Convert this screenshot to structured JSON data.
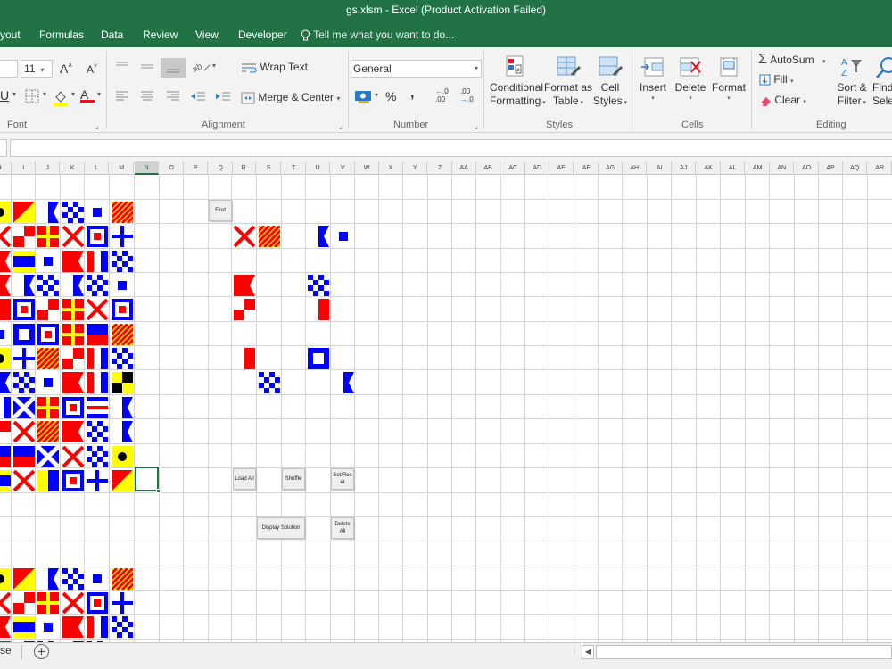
{
  "window": {
    "title": "gs.xlsm - Excel (Product Activation Failed)"
  },
  "tabs": [
    {
      "label": "yout"
    },
    {
      "label": "Formulas"
    },
    {
      "label": "Data"
    },
    {
      "label": "Review"
    },
    {
      "label": "View"
    },
    {
      "label": "Developer"
    }
  ],
  "tell_me": {
    "label": "Tell me what you want to do..."
  },
  "ribbon": {
    "font": {
      "size": "11",
      "group_label": "Font"
    },
    "alignment": {
      "wrap_text": "Wrap Text",
      "merge_center": "Merge & Center",
      "group_label": "Alignment"
    },
    "number": {
      "format": "General",
      "percent": "%",
      "comma": ",",
      "group_label": "Number"
    },
    "styles": {
      "conditional_formatting": [
        "Conditional",
        "Formatting"
      ],
      "format_as_table": [
        "Format as",
        "Table"
      ],
      "cell_styles": [
        "Cell",
        "Styles"
      ],
      "group_label": "Styles"
    },
    "cells": {
      "insert": "Insert",
      "delete": "Delete",
      "format": "Format",
      "group_label": "Cells"
    },
    "editing": {
      "autosum": "AutoSum",
      "fill": "Fill",
      "clear": "Clear",
      "sort_filter": [
        "Sort &",
        "Filter"
      ],
      "find_select": [
        "Find",
        "Selec"
      ],
      "group_label": "Editing"
    }
  },
  "columns": [
    "H",
    "I",
    "J",
    "K",
    "L",
    "M",
    "N",
    "O",
    "P",
    "Q",
    "R",
    "S",
    "T",
    "U",
    "V",
    "W",
    "X",
    "Y",
    "Z",
    "AA",
    "AB",
    "AC",
    "AD",
    "AE",
    "AF",
    "AG",
    "AH",
    "AI",
    "AJ",
    "AK",
    "AL",
    "AM",
    "AN",
    "AO",
    "AP",
    "AQ",
    "AR"
  ],
  "active_column": "N",
  "sheet_buttons": {
    "find": "Find",
    "load_all": "Load All",
    "shuffle": "Shuffle",
    "set_reset": [
      "Set/Res",
      "et"
    ],
    "display_solution": "Display Solution",
    "delete_all": [
      "Delete",
      "All"
    ]
  },
  "flag_grid": [
    [
      "I",
      "O",
      "A",
      "N",
      "S",
      "Y"
    ],
    [
      "V",
      "U",
      "R",
      "V",
      "W",
      "X"
    ],
    [
      "B",
      "D",
      "S",
      "B",
      "T",
      "N"
    ],
    [
      "B",
      "A",
      "N",
      "A",
      "N",
      "S"
    ],
    [
      "H",
      "W",
      "U",
      "R",
      "V",
      "W"
    ],
    [
      "S",
      "P",
      "W",
      "R",
      "E",
      "Y"
    ],
    [
      "I",
      "X",
      "Y",
      "U",
      "T",
      "N"
    ],
    [
      "A",
      "N",
      "S",
      "B",
      "T",
      "L"
    ],
    [
      "T",
      "M",
      "R",
      "W",
      "C",
      "A"
    ],
    [
      "U",
      "V",
      "Y",
      "B",
      "N",
      "A"
    ],
    [
      "E",
      "E",
      "M",
      "V",
      "N",
      "I"
    ],
    [
      "D",
      "V",
      "K",
      "W",
      "X",
      "O"
    ]
  ],
  "flag_grid_lower": [
    [
      "I",
      "O",
      "A",
      "N",
      "S",
      "Y"
    ],
    [
      "V",
      "U",
      "R",
      "V",
      "W",
      "X"
    ],
    [
      "B",
      "D",
      "S",
      "B",
      "T",
      "N"
    ],
    [
      "B",
      "A",
      "N",
      "A",
      "N",
      "S"
    ]
  ],
  "found_flags": [
    {
      "cell": "R-row2",
      "flag": "V"
    },
    {
      "cell": "S-row2",
      "flag": "Y"
    },
    {
      "cell": "U-row2",
      "flag": "A"
    },
    {
      "cell": "V-row2",
      "flag": "S"
    },
    {
      "cell": "R-row4",
      "flag": "B"
    },
    {
      "cell": "U-row4",
      "flag": "N"
    },
    {
      "cell": "R-row5",
      "flag": "U"
    },
    {
      "cell": "U-row5",
      "flag": "H"
    },
    {
      "cell": "R-row7",
      "flag": "H"
    },
    {
      "cell": "U-row7",
      "flag": "P"
    },
    {
      "cell": "S-row8",
      "flag": "N"
    },
    {
      "cell": "V-row8",
      "flag": "A"
    }
  ],
  "sheet_tab": {
    "label": "se"
  },
  "colors": {
    "excel_green": "#217346",
    "flag_red": "#ff0000",
    "flag_blue": "#0000ff",
    "flag_yellow": "#ffff00"
  }
}
